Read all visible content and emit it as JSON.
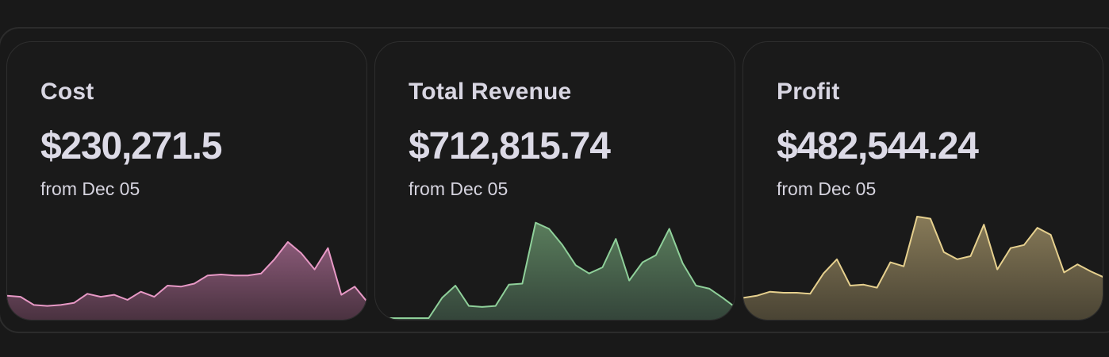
{
  "cards": [
    {
      "label": "Cost",
      "value": "$230,271.5",
      "sub": "from Dec 05",
      "stroke": "#e899c6",
      "fill_top": "#8a5a78",
      "fill_bottom": "#4a3240",
      "points": [
        0.22,
        0.21,
        0.13,
        0.12,
        0.13,
        0.15,
        0.24,
        0.21,
        0.23,
        0.18,
        0.26,
        0.21,
        0.32,
        0.31,
        0.34,
        0.42,
        0.43,
        0.42,
        0.42,
        0.44,
        0.58,
        0.75,
        0.64,
        0.48,
        0.69,
        0.23,
        0.31,
        0.15
      ]
    },
    {
      "label": "Total Revenue",
      "value": "$712,815.74",
      "sub": "from Dec 05",
      "stroke": "#8fd09a",
      "fill_top": "#5a7d5c",
      "fill_bottom": "#34453a",
      "points": [
        0.0,
        0.0,
        0.0,
        0.0,
        0.0,
        0.2,
        0.32,
        0.12,
        0.11,
        0.12,
        0.33,
        0.34,
        0.94,
        0.88,
        0.72,
        0.52,
        0.44,
        0.5,
        0.78,
        0.37,
        0.55,
        0.62,
        0.88,
        0.54,
        0.32,
        0.29,
        0.2,
        0.1
      ]
    },
    {
      "label": "Profit",
      "value": "$482,544.24",
      "sub": "from Dec 05",
      "stroke": "#e6d08e",
      "fill_top": "#877a58",
      "fill_bottom": "#4a4434",
      "points": [
        0.2,
        0.22,
        0.26,
        0.25,
        0.25,
        0.24,
        0.44,
        0.58,
        0.32,
        0.33,
        0.3,
        0.55,
        0.51,
        1.0,
        0.98,
        0.65,
        0.58,
        0.61,
        0.92,
        0.48,
        0.69,
        0.72,
        0.89,
        0.82,
        0.45,
        0.53,
        0.46,
        0.4
      ]
    }
  ]
}
